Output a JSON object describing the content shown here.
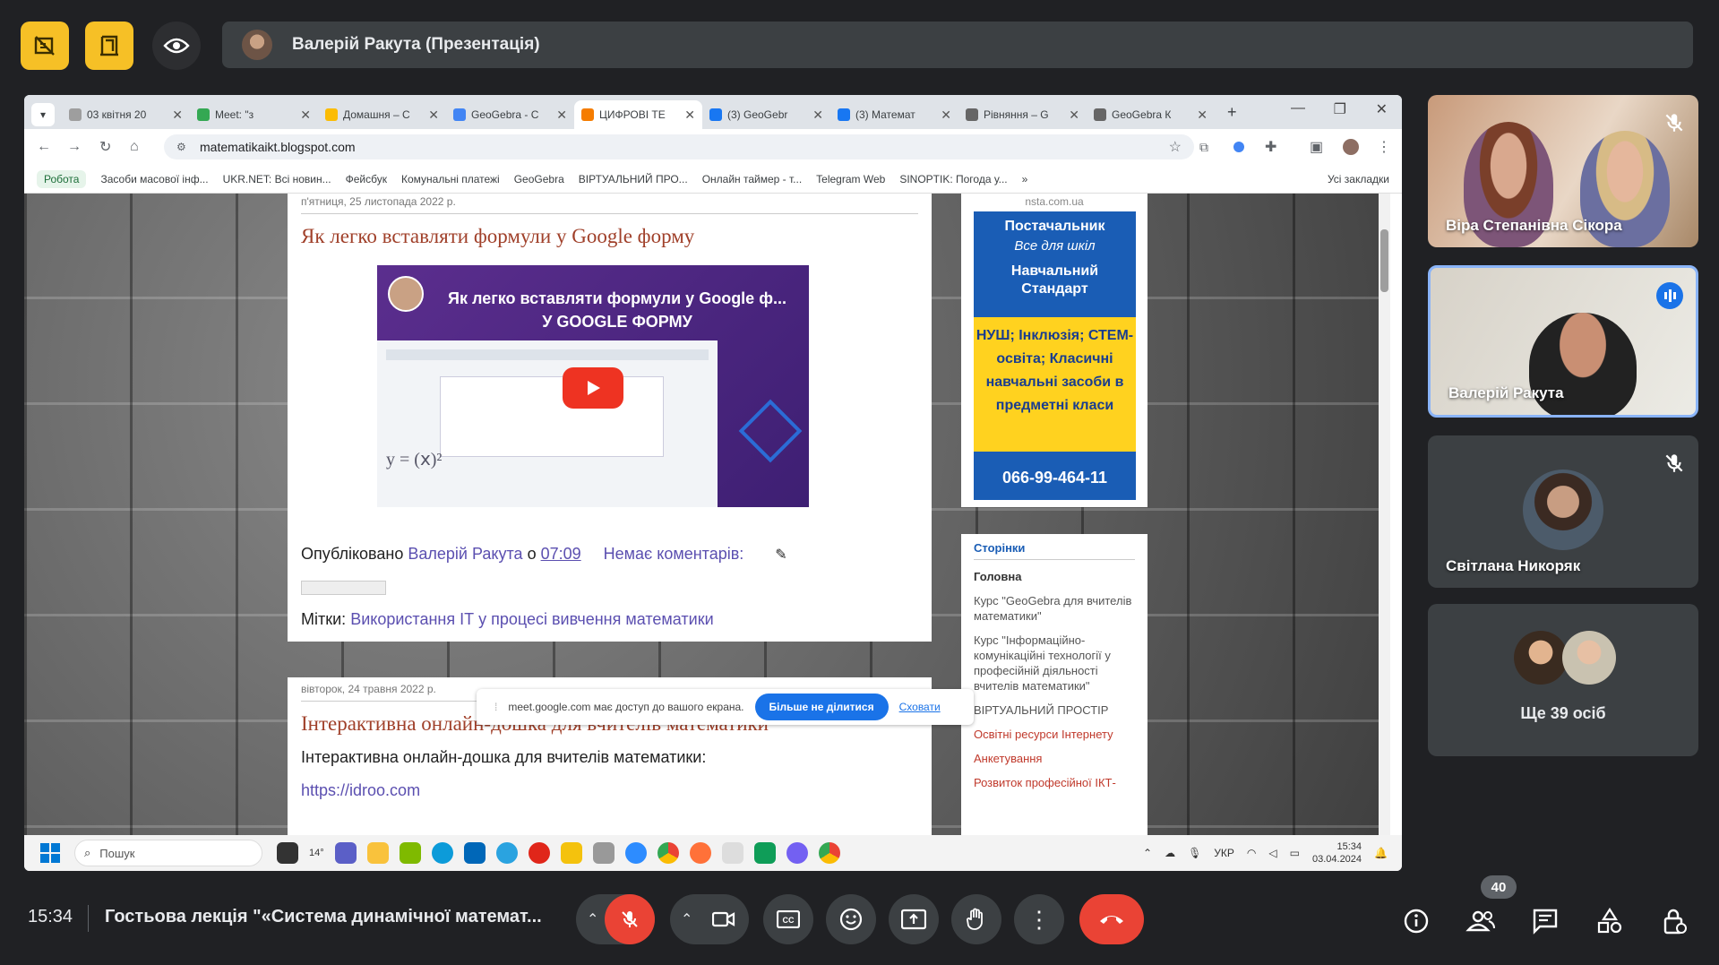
{
  "meet": {
    "presenter_bar": "Валерій Ракута (Презентація)",
    "time": "15:34",
    "meeting_title": "Гостьова лекція \"«Система динамічної математ...",
    "participants_count": "40"
  },
  "browser": {
    "tabs": [
      {
        "label": "03 квітня 20",
        "color": "#9e9e9e"
      },
      {
        "label": "Meet: \"з",
        "color": "#34a853"
      },
      {
        "label": "Домашня – С",
        "color": "#fbbc04"
      },
      {
        "label": "GeoGebra - С",
        "color": "#4285f4"
      },
      {
        "label": "ЦИФРОВІ ТЕ",
        "color": "#f57c00"
      },
      {
        "label": "(3) GeoGebr",
        "color": "#1877f2"
      },
      {
        "label": "(3) Математ",
        "color": "#1877f2"
      },
      {
        "label": "Рівняння – G",
        "color": "#666666"
      },
      {
        "label": "GeoGebra К",
        "color": "#666666"
      }
    ],
    "url": "matematikaikt.blogspot.com",
    "bookmarks": [
      "Робота",
      "Засоби масової інф...",
      "UKR.NET: Всі новин...",
      "Фейсбук",
      "Комунальні платежі",
      "GeoGebra",
      "ВІРТУАЛЬНИЙ ПРО...",
      "Онлайн таймер - т...",
      "Telegram Web",
      "SINOPTIK: Погода у...",
      "»",
      "Усі закладки"
    ]
  },
  "blog": {
    "post1": {
      "date": "п'ятниця, 25 листопада 2022 р.",
      "title": "Як легко вставляти формули у Google форму",
      "video_text_top": "Як легко вставляти формули у Google ф...",
      "video_text_bottom": "У GOOGLE ФОРМУ",
      "published_prefix": "Опубліковано",
      "author": "Валерій Ракута",
      "at": "о",
      "time": "07:09",
      "comments": "Немає коментарів:",
      "labels_prefix": "Мітки:",
      "labels": "Використання ІТ у процесі вивчення математики"
    },
    "post2": {
      "date": "вівторок, 24 травня 2022 р.",
      "title": "Інтерактивна онлайн-дошка для вчителів математики",
      "snippet": "Інтерактивна онлайн-дошка для вчителів математики:",
      "link": "https://idroo.com"
    },
    "ad": {
      "site": "nsta.com.ua",
      "line1": "Постачальник",
      "line2": "Все для шкіл",
      "line3": "Навчальний Стандарт",
      "yellow": "НУШ; Інклюзія; СТЕМ-освіта; Класичні навчальні засоби в предметні класи",
      "phone": "066-99-464-11"
    },
    "pages": {
      "heading": "Сторінки",
      "items": [
        "Головна",
        "Курс \"GeoGebra для вчителів математики\"",
        "Курс \"Інформаційно-комунікаційні технології у професійній діяльності вчителів математики\"",
        "ВІРТУАЛЬНИЙ ПРОСТІР",
        "Освітні ресурси Інтернету",
        "Анкетування",
        "Розвиток професійної ІКТ-"
      ]
    }
  },
  "share_notice": {
    "text": "meet.google.com має доступ до вашого екрана.",
    "stop": "Більше не ділитися",
    "hide": "Сховати"
  },
  "taskbar": {
    "search_placeholder": "Пошук",
    "lang": "УКР",
    "clock_time": "15:34",
    "clock_date": "03.04.2024",
    "weather": "14°"
  },
  "participants": [
    {
      "name": "Віра Степанівна Сікора",
      "muted": true
    },
    {
      "name": "Валерій Ракута",
      "speaking": true
    },
    {
      "name": "Світлана Никоряк",
      "muted": true
    },
    {
      "name": "Ще 39 осіб"
    }
  ],
  "colors": {
    "accent_yellow": "#f6c026",
    "end_call_red": "#ea4335",
    "speaking_border": "#8ab4f8"
  }
}
